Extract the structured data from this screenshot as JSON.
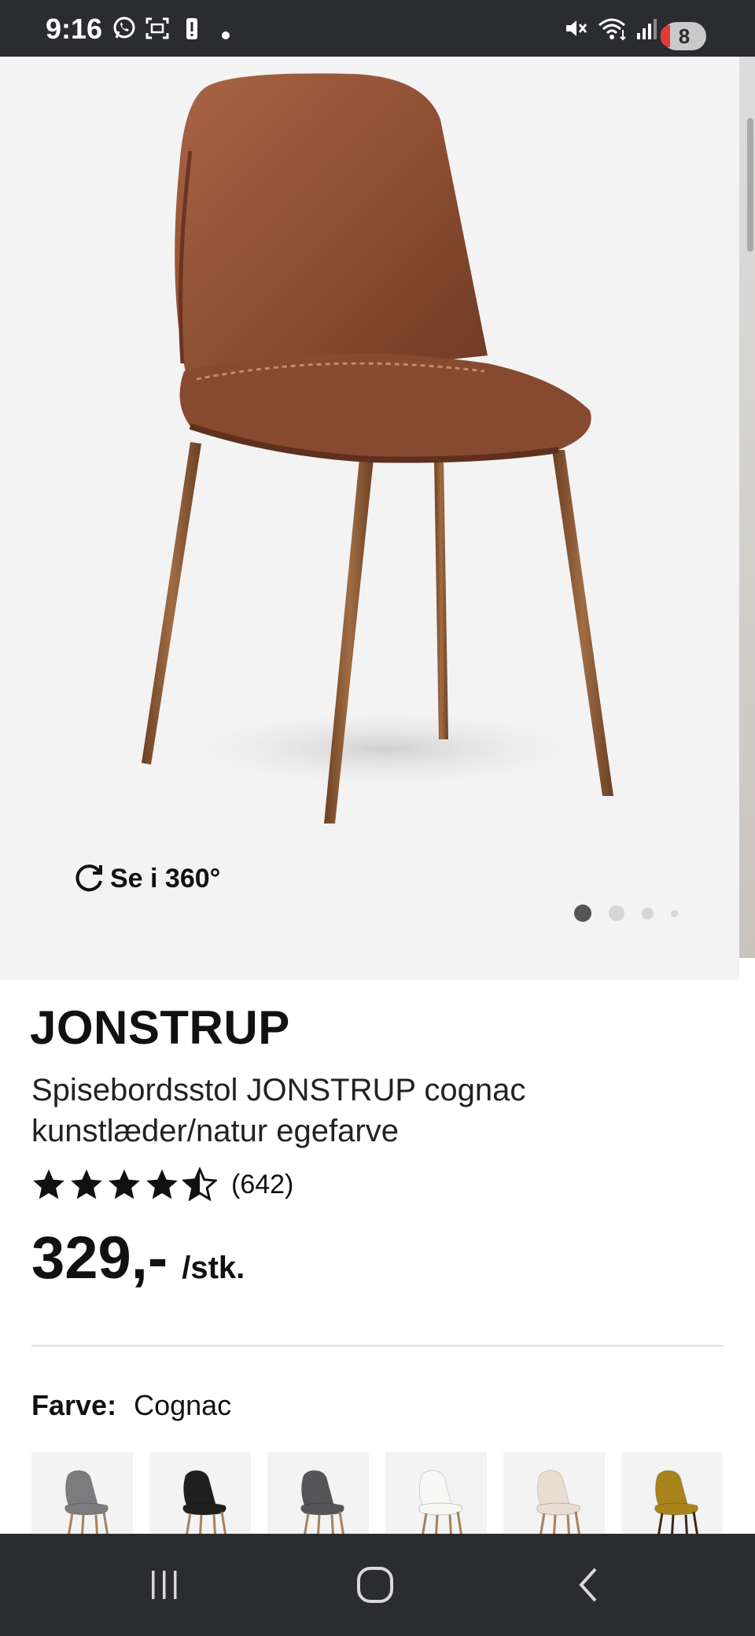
{
  "status_bar": {
    "time": "9:16",
    "notification_count": "8",
    "icons": [
      "whatsapp-icon",
      "screenshot-icon",
      "battery-alert-icon",
      "mute-icon",
      "wifi-icon",
      "signal-icon"
    ]
  },
  "gallery": {
    "view360_label": "Se i 360°",
    "icons": [
      "rotate-icon"
    ],
    "page_count": 4,
    "active_page": 1
  },
  "product": {
    "brand": "JONSTRUP",
    "description": "Spisebordsstol JONSTRUP cognac kunstlæder/natur egefarve",
    "rating": 4.5,
    "review_count": "(642)",
    "price": "329,-",
    "price_unit": "/stk.",
    "color_label": "Farve:",
    "color_value": "Cognac"
  },
  "swatches": [
    {
      "name": "swatch-grey",
      "color": "#7c7c7e"
    },
    {
      "name": "swatch-black",
      "color": "#1f1f1f"
    },
    {
      "name": "swatch-dark-grey",
      "color": "#555557"
    },
    {
      "name": "swatch-white",
      "color": "#f7f7f5"
    },
    {
      "name": "swatch-sheepskin",
      "color": "#e8ddd0"
    },
    {
      "name": "swatch-mustard",
      "color": "#a9841c"
    }
  ],
  "colors": {
    "system_bar": "#2b2c30",
    "image_background": "#f3f3f3",
    "leather": "#8e4f33",
    "wood": "#8a5a35"
  },
  "nav_bar": {
    "icons": [
      "recent-apps-icon",
      "home-icon",
      "back-icon"
    ]
  }
}
